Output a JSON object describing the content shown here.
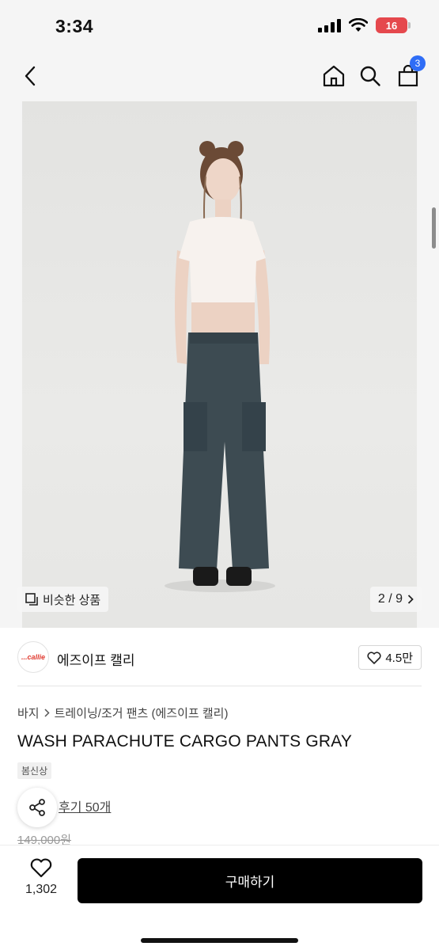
{
  "status_bar": {
    "time": "3:34",
    "battery": "16"
  },
  "nav": {
    "cart_count": "3"
  },
  "gallery": {
    "similar_label": "비슷한 상품",
    "page_indicator": "2 / 9"
  },
  "brand": {
    "logo_text": "...callie",
    "name": "에즈이프 캘리",
    "likes": "4.5만"
  },
  "product": {
    "breadcrumb": {
      "category": "바지",
      "subcategory": "트레이닝/조거 팬츠 (에즈이프 캘리)"
    },
    "title": "WASH PARACHUTE CARGO PANTS GRAY",
    "tag": "봄신상",
    "review_link": "후기 50개",
    "original_price": "149,000원"
  },
  "bottom_bar": {
    "wish_count": "1,302",
    "buy_label": "구매하기"
  },
  "colors": {
    "accent_badge": "#2f6df6",
    "buy_button": "#000000",
    "battery": "#e5484d"
  }
}
